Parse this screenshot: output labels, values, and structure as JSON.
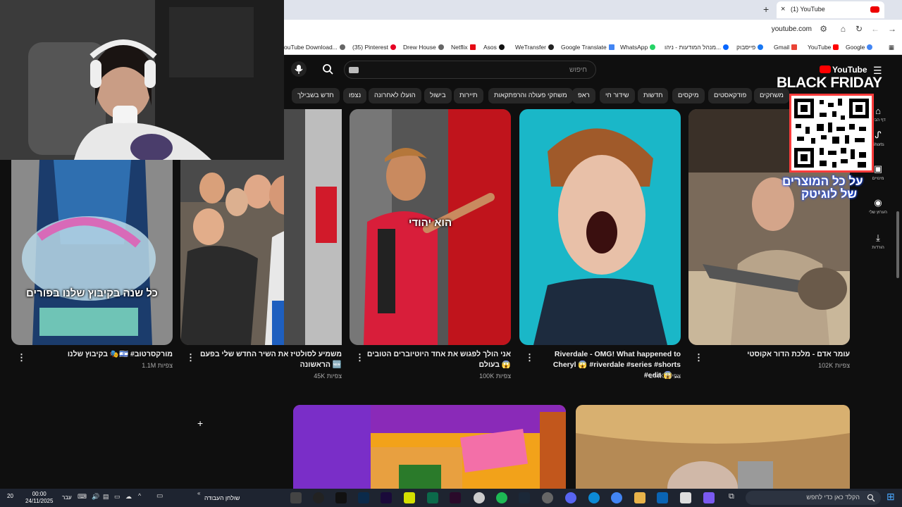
{
  "browser": {
    "tab_title": "(1) YouTube",
    "url": "youtube.com",
    "bookmarks": [
      {
        "label": "ouTube Download..."
      },
      {
        "label": "(35) Pinterest"
      },
      {
        "label": "Drew House"
      },
      {
        "label": "Netflix"
      },
      {
        "label": "Asos"
      },
      {
        "label": "WeTransfer"
      },
      {
        "label": "Google Translate"
      },
      {
        "label": "WhatsApp"
      },
      {
        "label": "מנהל המודעות - ניהו..."
      },
      {
        "label": "פייסבוק"
      },
      {
        "label": "Gmail"
      },
      {
        "label": "YouTube"
      },
      {
        "label": "Google"
      }
    ]
  },
  "youtube": {
    "logo": "YouTube",
    "search_placeholder": "חיפוש",
    "chips": [
      "משחקים",
      "פודקאסטים",
      "מיקסים",
      "חדשות",
      "שידור חי",
      "ראפ",
      "משחקי פעולה והרפתקאות",
      "תיירות",
      "בישול",
      "הועלו לאחרונה",
      "נצפו",
      "חדש בשבילך"
    ],
    "rail": [
      "דף הבית",
      "Shorts",
      "מינויים",
      "הערוץ שלי",
      "הורדות"
    ],
    "promo": {
      "headline": "BLACK FRIDAY",
      "line1": "על כל המוצרים",
      "line2": "של לוגיטק"
    },
    "shorts": [
      {
        "title": "עומר אדם - מלכת הדור אקוסטי",
        "views": "102K צפיות",
        "overlay": ""
      },
      {
        "title": "Riverdale - OMG! What happened to Cheryl 😱 #riverdale #series #shorts #edit 😱 ...",
        "views": "144K צפיות",
        "overlay": ""
      },
      {
        "title": "אני הולך לפגוש את אחד היוטיוברים הטובים בעולם 😱",
        "views": "100K צפיות",
        "overlay": "הוא יהודי"
      },
      {
        "title": "משמיע לסולטיז את השיר החדש שלי בפעם הראשונה 🆕",
        "views": "45K צפיות",
        "overlay": ""
      },
      {
        "title": "בקיבוץ שלנו 🎭🇮🇱 #מורקסרטוב",
        "views": "1.1M צפיות",
        "overlay": "כל שנה בקיבוץ שלנו בפורים"
      }
    ]
  },
  "taskbar": {
    "time": "00:00",
    "date": "24/11/2025",
    "lang": "עבר",
    "desktop_label": "שולחן העבודה",
    "search_placeholder": "הקלד כאן כדי לחפש",
    "notif_count": "20"
  }
}
